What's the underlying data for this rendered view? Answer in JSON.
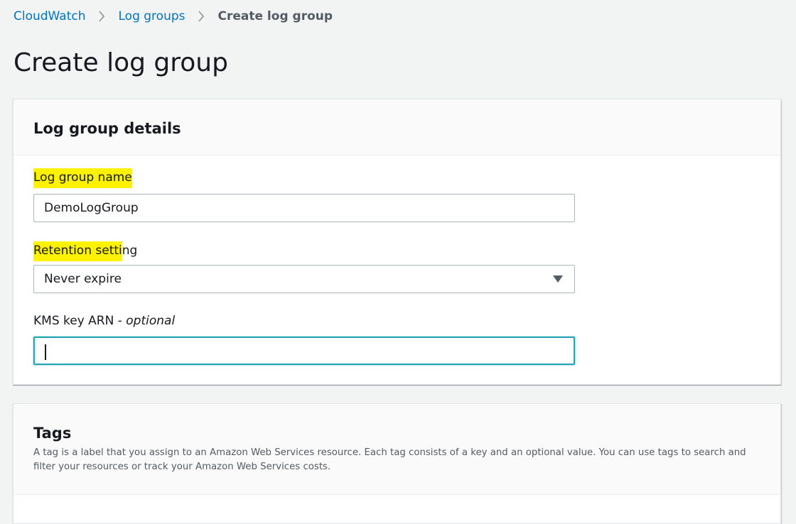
{
  "breadcrumb": {
    "items": [
      "CloudWatch",
      "Log groups",
      "Create log group"
    ]
  },
  "page": {
    "title": "Create log group"
  },
  "details_panel": {
    "title": "Log group details",
    "name_field": {
      "label": "Log group name",
      "value": "DemoLogGroup"
    },
    "retention_field": {
      "label_highlighted": "Retention setti",
      "label_rest": "ng",
      "value": "Never expire"
    },
    "kms_field": {
      "label": "KMS key ARN - ",
      "label_optional": "optional",
      "value": ""
    }
  },
  "tags_panel": {
    "title": "Tags",
    "description": "A tag is a label that you assign to an Amazon Web Services resource. Each tag consists of a key and an optional value. You can use tags to search and filter your resources or track your Amazon Web Services costs."
  },
  "colors": {
    "link": "#0073bb",
    "highlight": "#fff200",
    "focus_border": "#2aa5b4",
    "background": "#f2f3f3"
  },
  "icons": {
    "separator": "chevron-right-icon",
    "select_caret": "caret-down-icon"
  }
}
